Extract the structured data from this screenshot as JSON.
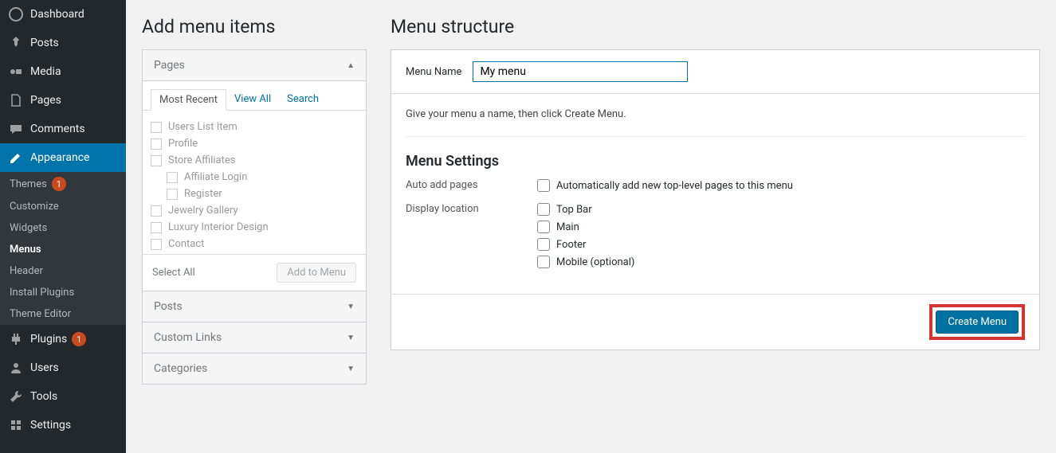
{
  "sidebar": {
    "items": [
      {
        "label": "Dashboard",
        "icon": "dashboard"
      },
      {
        "label": "Posts",
        "icon": "pin"
      },
      {
        "label": "Media",
        "icon": "media"
      },
      {
        "label": "Pages",
        "icon": "pages"
      },
      {
        "label": "Comments",
        "icon": "comments"
      },
      {
        "label": "Appearance",
        "icon": "appearance",
        "active": true
      },
      {
        "label": "Plugins",
        "icon": "plugins",
        "badge": "1"
      },
      {
        "label": "Users",
        "icon": "users"
      },
      {
        "label": "Tools",
        "icon": "tools"
      },
      {
        "label": "Settings",
        "icon": "settings"
      }
    ],
    "submenu": [
      {
        "label": "Themes",
        "badge": "1"
      },
      {
        "label": "Customize"
      },
      {
        "label": "Widgets"
      },
      {
        "label": "Menus",
        "current": true
      },
      {
        "label": "Header"
      },
      {
        "label": "Install Plugins"
      },
      {
        "label": "Theme Editor"
      }
    ]
  },
  "addMenu": {
    "heading": "Add menu items",
    "sections": {
      "pages": {
        "title": "Pages",
        "tabs": [
          "Most Recent",
          "View All",
          "Search"
        ],
        "items": [
          {
            "label": "Users List Item"
          },
          {
            "label": "Profile"
          },
          {
            "label": "Store Affiliates"
          },
          {
            "label": "Affiliate Login",
            "indent": true
          },
          {
            "label": "Register",
            "indent": true
          },
          {
            "label": "Jewelry Gallery"
          },
          {
            "label": "Luxury Interior Design"
          },
          {
            "label": "Contact"
          }
        ],
        "selectAll": "Select All",
        "addBtn": "Add to Menu"
      },
      "posts": "Posts",
      "customLinks": "Custom Links",
      "categories": "Categories"
    }
  },
  "menuStructure": {
    "heading": "Menu structure",
    "menuNameLabel": "Menu Name",
    "menuNameValue": "My menu",
    "instruction": "Give your menu a name, then click Create Menu.",
    "settingsHeading": "Menu Settings",
    "autoAdd": {
      "label": "Auto add pages",
      "option": "Automatically add new top-level pages to this menu"
    },
    "displayLocation": {
      "label": "Display location",
      "options": [
        "Top Bar",
        "Main",
        "Footer",
        "Mobile (optional)"
      ]
    },
    "createBtn": "Create Menu"
  }
}
